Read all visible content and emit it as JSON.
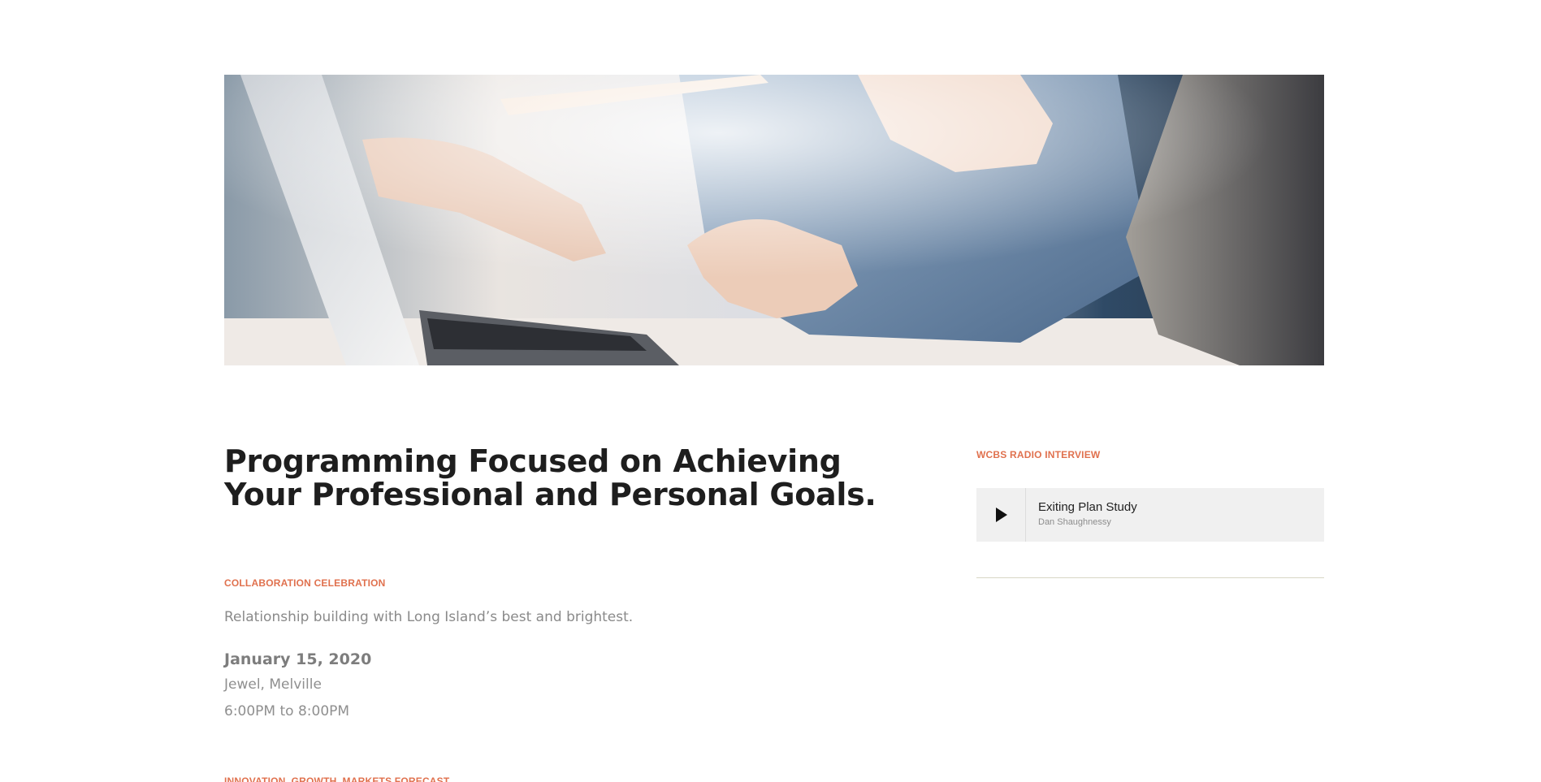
{
  "hero": {
    "image_alt": "Hands pointing at a laptop screen during a meeting"
  },
  "main": {
    "title": "Programming Focused on Achieving Your Professional and Personal Goals."
  },
  "event": {
    "category": "COLLABORATION CELEBRATION",
    "description": "Relationship building with Long Island’s best and brightest.",
    "date": "January 15, 2020",
    "venue": "Jewel, Melville",
    "time": "6:00PM to 8:00PM"
  },
  "next_event": {
    "category": "INNOVATION, GROWTH, MARKETS FORECAST"
  },
  "sidebar": {
    "heading": "WCBS RADIO INTERVIEW",
    "player": {
      "track_title": "Exiting Plan Study",
      "track_artist": "Dan Shaughnessy",
      "play_icon": "play-icon"
    }
  },
  "colors": {
    "accent": "#e0714e",
    "title": "#1e1e1e",
    "muted_text": "#8a8a8a",
    "player_bg": "#f0f0f0",
    "divider": "#d8d6c4"
  }
}
